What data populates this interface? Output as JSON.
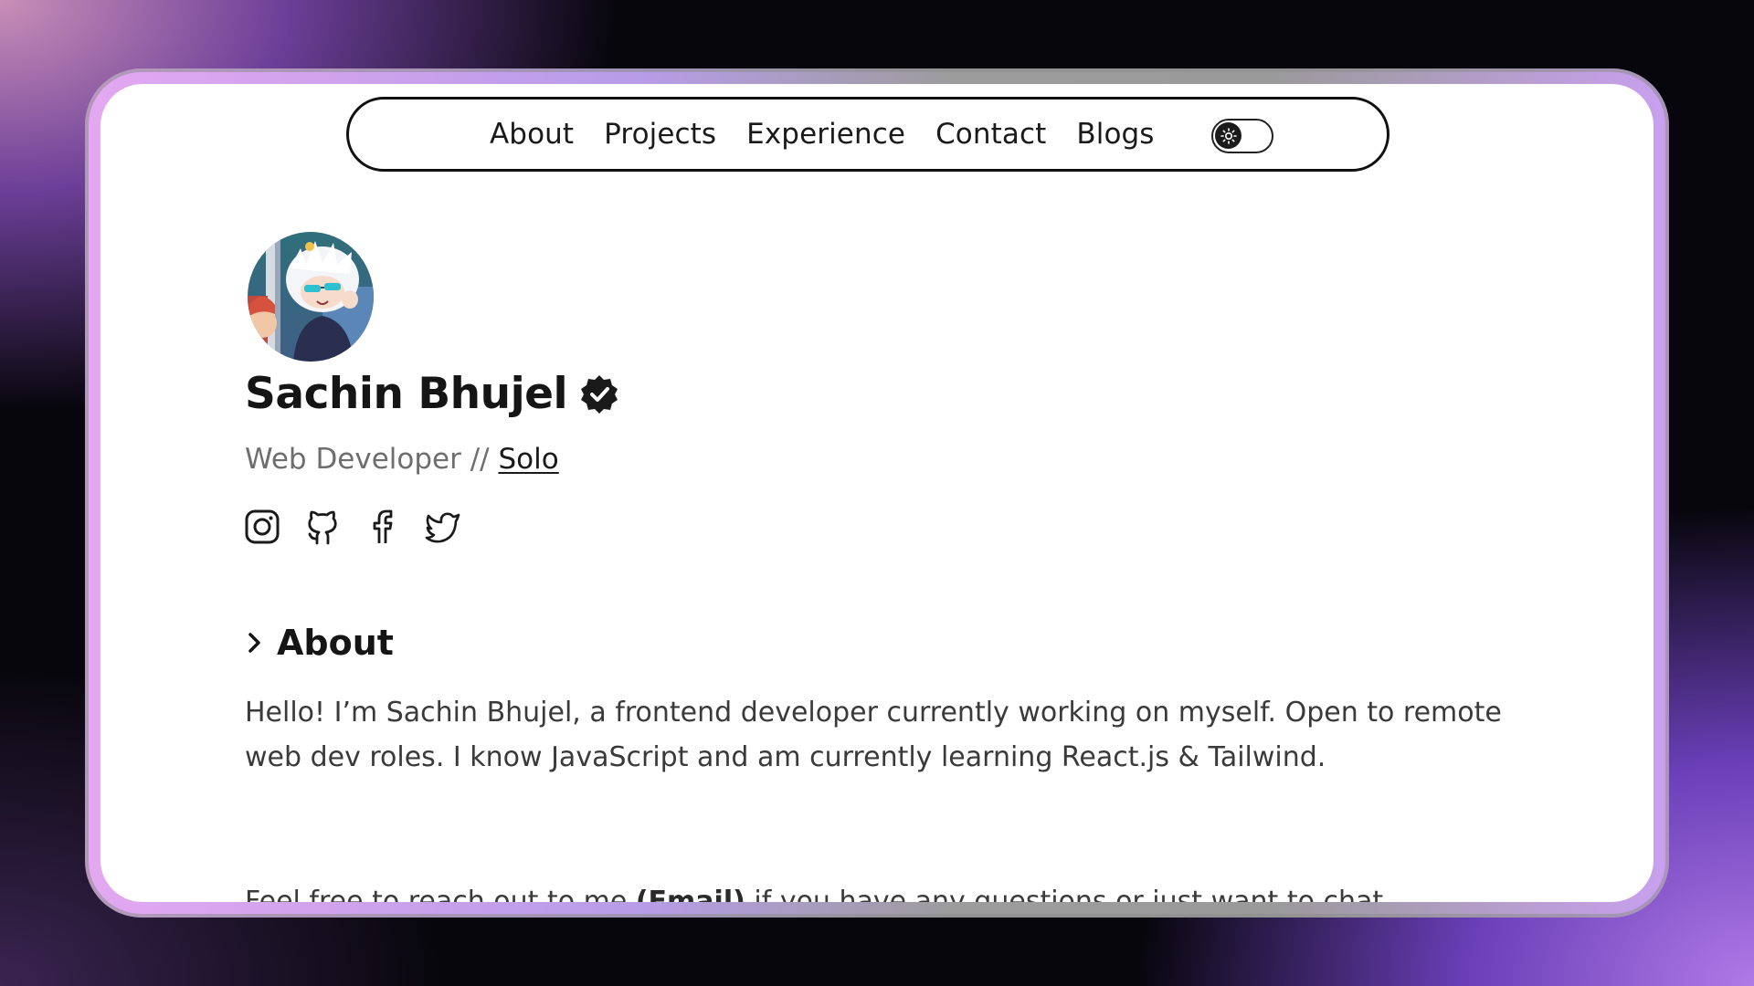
{
  "nav": {
    "links": [
      "About",
      "Projects",
      "Experience",
      "Contact",
      "Blogs"
    ],
    "theme_toggle_state": "light"
  },
  "profile": {
    "name": "Sachin Bhujel",
    "role": "Web Developer",
    "separator": "//",
    "company": "Solo",
    "socials": [
      "instagram-icon",
      "github-icon",
      "facebook-icon",
      "twitter-icon"
    ]
  },
  "about": {
    "heading": "About",
    "paragraph1": "Hello! I’m Sachin Bhujel, a frontend developer currently working on myself. Open to remote web dev roles. I know JavaScript and am currently learning React.js & Tailwind.",
    "paragraph2_before": "Feel free to reach out to me ",
    "paragraph2_email": "(Email)",
    "paragraph2_after": " if you have any questions or just want to chat."
  },
  "colors": {
    "text_primary": "#151515",
    "text_muted": "#6e6e6e",
    "frame_gradient_start": "#e3a8f0",
    "frame_gradient_end": "#c9a0f0"
  }
}
